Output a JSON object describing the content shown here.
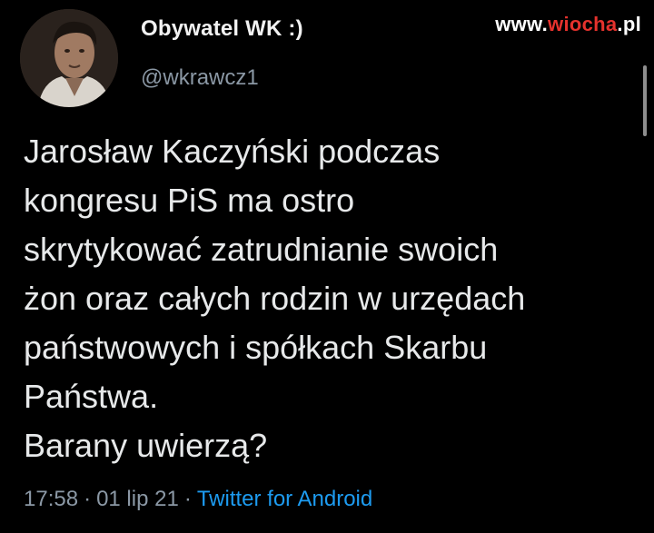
{
  "watermark": {
    "prefix": "www.",
    "accent": "wiocha",
    "suffix": ".pl"
  },
  "author": {
    "display_name": "Obywatel WK :)",
    "handle": "@wkrawcz1"
  },
  "tweet": {
    "text": "Jarosław Kaczyński podczas\nkongresu PiS ma ostro\nskrytykować zatrudnianie swoich\nżon oraz całych rodzin w urzędach\npaństwowych i spółkach Skarbu\nPaństwa.\nBarany uwierzą?"
  },
  "meta": {
    "time": "17:58",
    "date": "01 lip 21",
    "separator": "·",
    "source": "Twitter for Android"
  },
  "colors": {
    "background": "#000000",
    "text": "#e7e9ea",
    "secondary": "#8b98a5",
    "link": "#1d9bf0",
    "watermark_accent": "#e5322d"
  }
}
